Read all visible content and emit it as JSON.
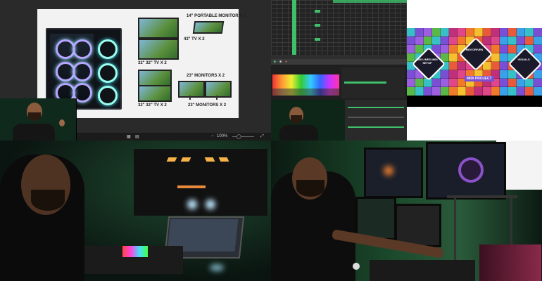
{
  "slide": {
    "labels": {
      "portable_monitor": "14\" PORTABLE MONITOR X 1",
      "tv_43": "43\" TV X 2",
      "tv_32_a": "32\"  32\" TV X 2",
      "monitors_23_a": "23\" MONITORS X 2",
      "tv_32_b": "32\"  32\" TV X 2",
      "monitors_23_b": "23\" MONITORS X 2"
    },
    "toolbar": {
      "zoom": "100%"
    }
  },
  "pattern": {
    "labels": {
      "logo_left": "500 LINES MIDI SETUP",
      "logo_center": "MIDI DRIVEN",
      "logo_right": "VISUALS",
      "bottom_tag": "MIDI PROJECT"
    }
  },
  "colors": {
    "accent_green": "#3fbf6a",
    "daw_bg": "#232323",
    "pattern_purple": "#7a4fd6"
  }
}
